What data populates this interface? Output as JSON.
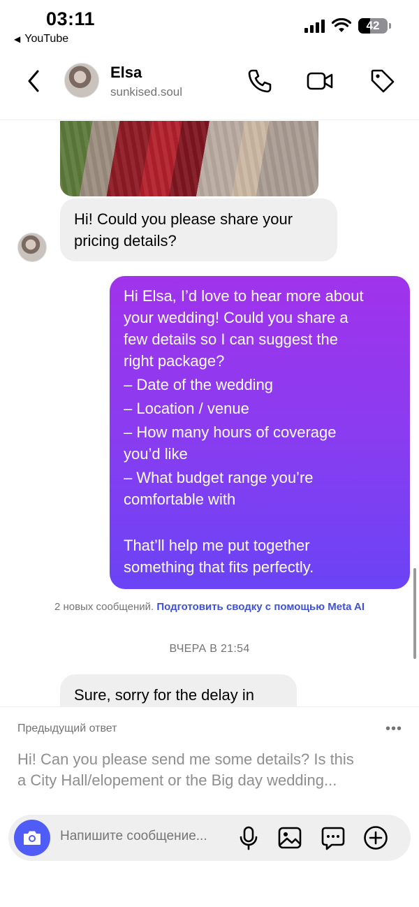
{
  "status_bar": {
    "time": "03:11",
    "back_app": "YouTube",
    "battery": "42"
  },
  "header": {
    "name": "Elsa",
    "handle": "sunkised.soul"
  },
  "messages": {
    "incoming_1": {
      "lines": [
        "Hi! Could you please share your",
        "pricing details?"
      ]
    },
    "outgoing_1": {
      "lines": [
        "Hi Elsa, I’d love to hear more about",
        "your wedding! Could you share a",
        "few details so I can suggest the",
        "right package?",
        "– Date of the wedding",
        "– Location / venue",
        "– How many hours of coverage",
        "you’d like",
        "– What budget range you’re",
        "comfortable with",
        "",
        "That’ll help me put together",
        "something that fits perfectly."
      ]
    },
    "new_messages_notice": "2 новых сообщений.",
    "summary_link": "Подготовить сводку с помощью Meta AI",
    "timestamp": "ВЧЕРА В 21:54",
    "incoming_2": {
      "text": "Sure, sorry for the delay in"
    }
  },
  "reply_preview": {
    "title": "Предыдущий ответ",
    "more": "•••",
    "lines": [
      "Hi! Can you please send me some details? Is this",
      "a City Hall/elopement or the Big day wedding..."
    ]
  },
  "composer": {
    "placeholder": "Напишите сообщение..."
  },
  "colors": {
    "accent": "#4f5cf6",
    "bubble_out_top": "#a033ec",
    "bubble_out_bottom": "#6a44f5",
    "link": "#3f51d8"
  }
}
